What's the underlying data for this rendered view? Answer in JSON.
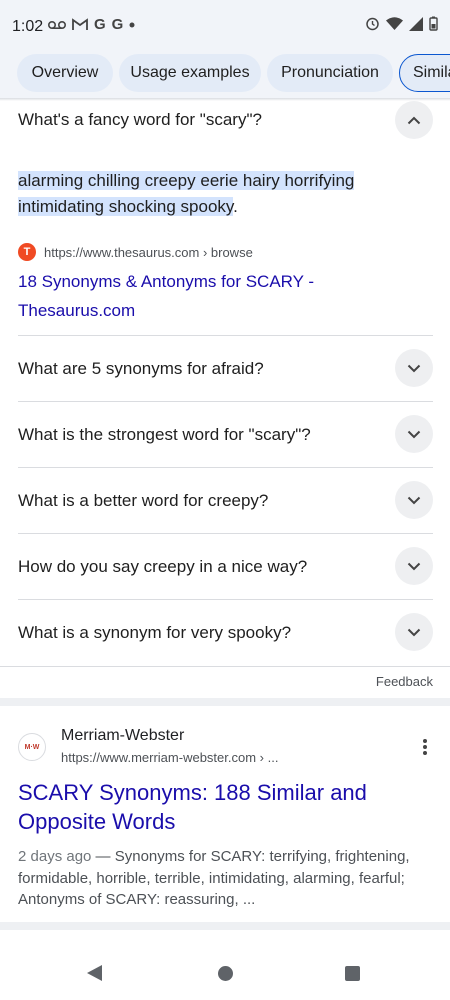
{
  "status_bar": {
    "time": "1:02",
    "left_icons": [
      "voicemail-icon",
      "gmail-icon",
      "google-icon",
      "google-icon",
      "dot-icon"
    ],
    "right_icons": [
      "alarm-icon",
      "wifi-icon",
      "signal-icon",
      "battery-icon"
    ]
  },
  "tabs": [
    {
      "label": "Overview"
    },
    {
      "label": "Usage examples"
    },
    {
      "label": "Pronunciation"
    },
    {
      "label": "Simila"
    }
  ],
  "faq": {
    "open_question": "What's a fancy word for \"scary\"?",
    "answer_highlight_line1": "alarming chilling creepy eerie hairy horrifying",
    "answer_highlight_line2": "intimidating shocking spooky",
    "answer_tail": ".",
    "source_url": "https://www.thesaurus.com › browse",
    "source_title": "18 Synonyms & Antonyms for SCARY - Thesaurus.com",
    "questions": [
      "What are 5 synonyms for afraid?",
      "What is the strongest word for \"scary\"?",
      "What is a better word for creepy?",
      "How do you say creepy in a nice way?",
      "What is a synonym for very spooky?"
    ],
    "feedback": "Feedback"
  },
  "result": {
    "logo_text": "M·W",
    "site_name": "Merriam-Webster",
    "url": "https://www.merriam-webster.com › ...",
    "title": "SCARY Synonyms: 188 Similar and Opposite Words",
    "date": "2 days ago",
    "snippet": " — Synonyms for SCARY: terrifying, frightening, formidable, horrible, terrible, intimidating, alarming, fearful; Antonyms of SCARY: reassuring, ..."
  },
  "colors": {
    "link": "#1a0dab",
    "highlight": "#d3e3fd",
    "tab_bg": "#e3ebf7",
    "active_tab_border": "#0b57d0"
  }
}
